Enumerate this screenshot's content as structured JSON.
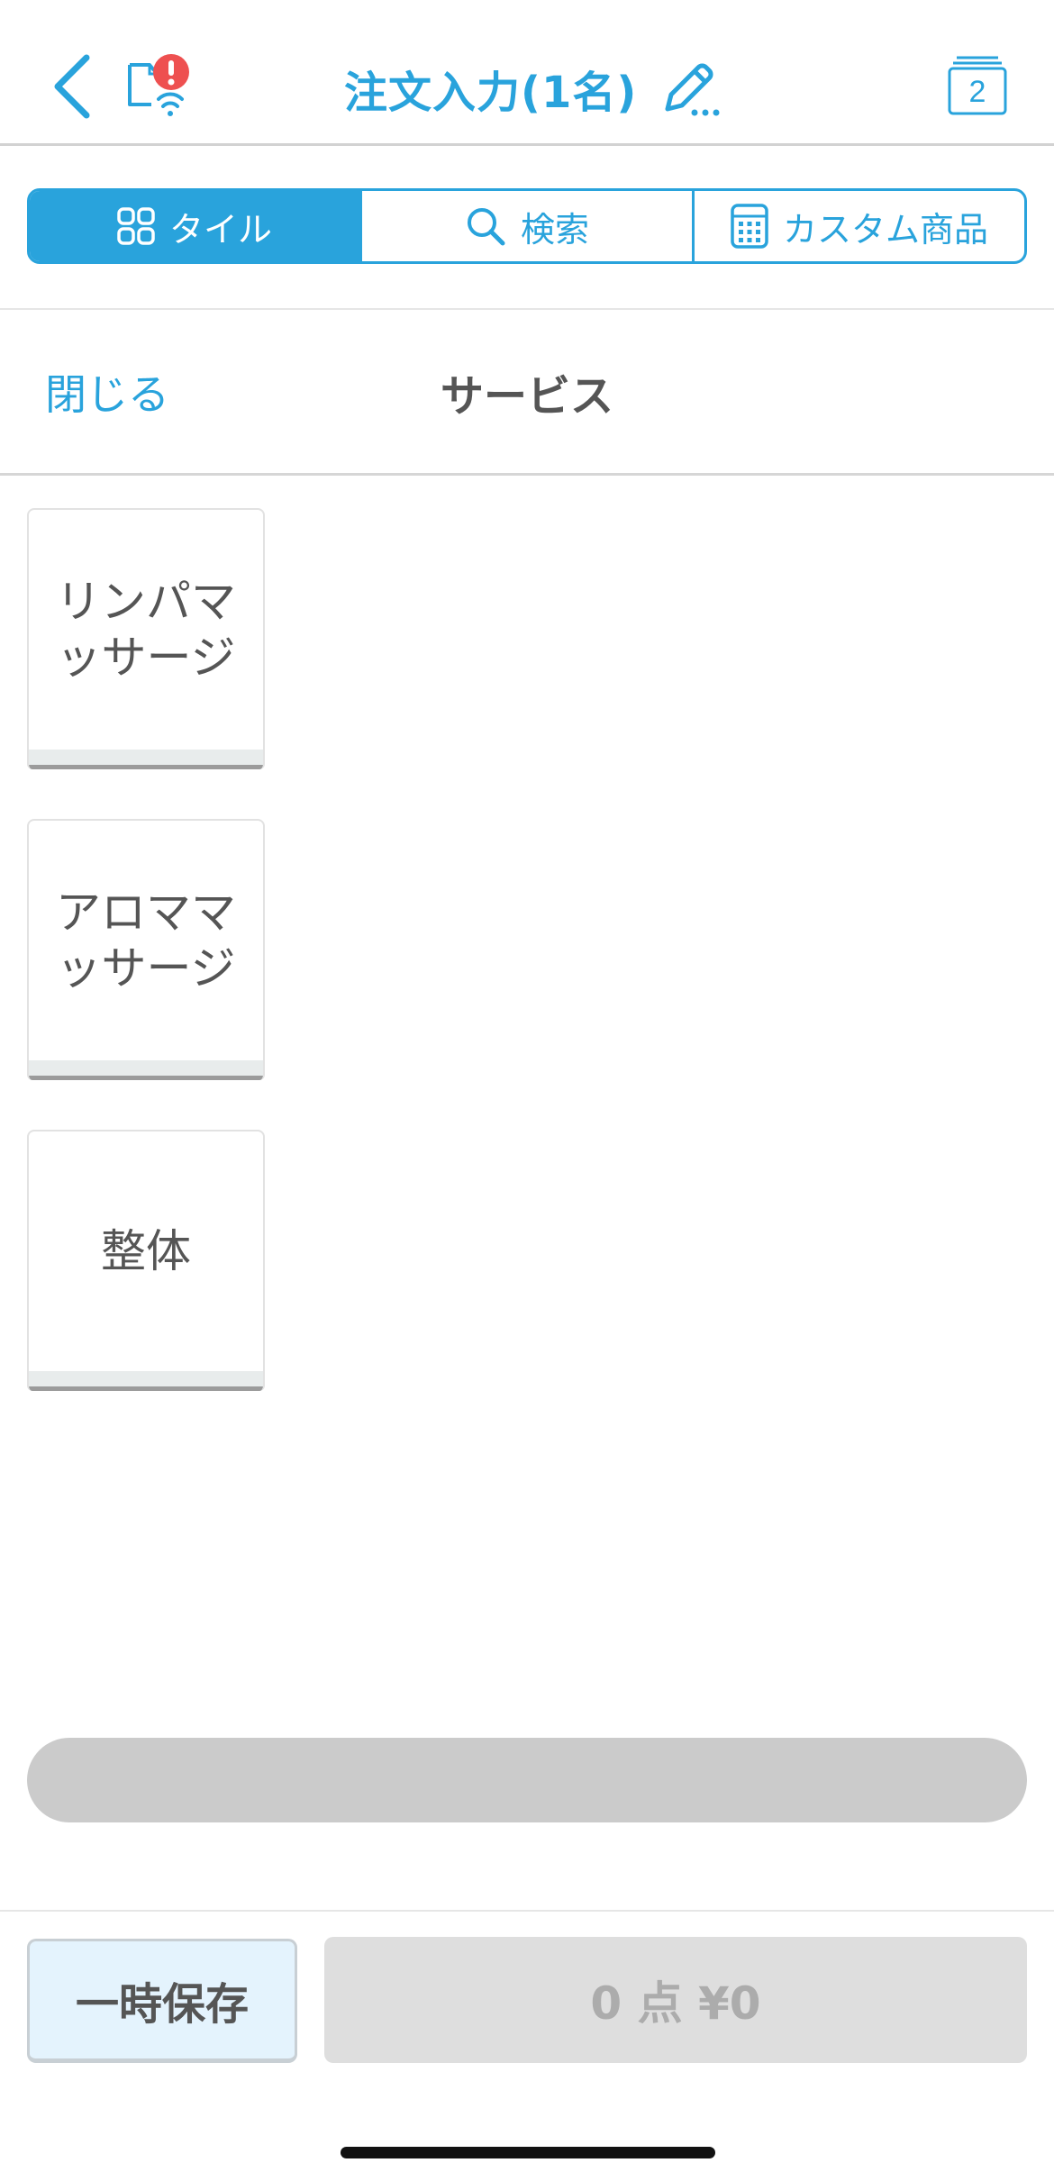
{
  "nav": {
    "title": "注文入力(1名)",
    "order_count": "2"
  },
  "tabs": [
    {
      "label": "タイル",
      "icon": "grid-icon",
      "active": true
    },
    {
      "label": "検索",
      "icon": "search-icon",
      "active": false
    },
    {
      "label": "カスタム商品",
      "icon": "calculator-icon",
      "active": false
    }
  ],
  "category": {
    "close_label": "閉じる",
    "title": "サービス"
  },
  "tiles": [
    {
      "label": "リンパマッサージ"
    },
    {
      "label": "アロママッサージ"
    },
    {
      "label": "整体"
    }
  ],
  "footer": {
    "hold_label": "一時保存",
    "total_label": "0 点 ¥0"
  },
  "colors": {
    "accent": "#29a3dc",
    "alert": "#ee5050",
    "text": "#555555"
  }
}
